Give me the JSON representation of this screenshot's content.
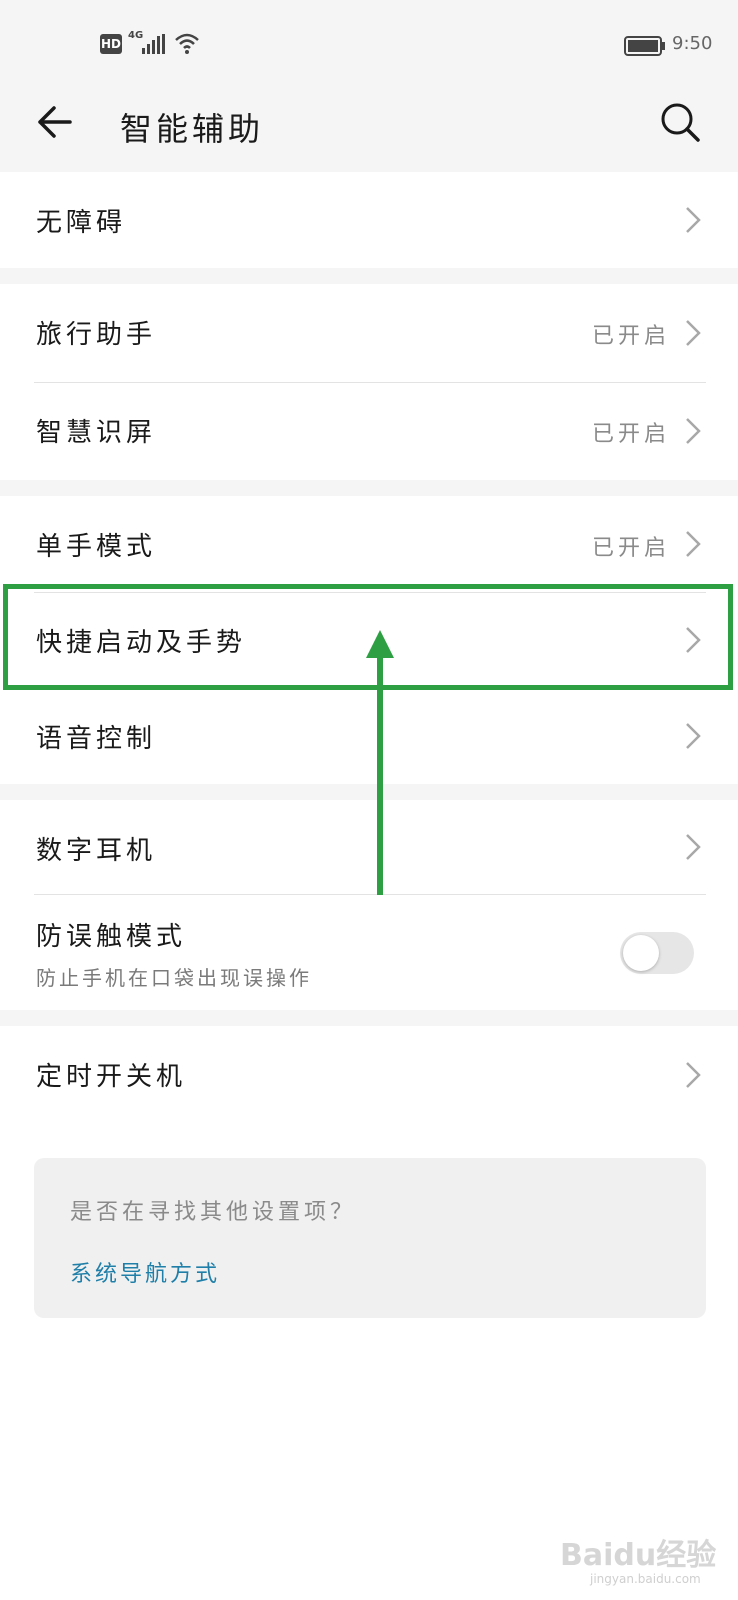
{
  "status_bar": {
    "hd": "HD",
    "network": "4G",
    "time": "9:50"
  },
  "header": {
    "title": "智能辅助",
    "back_icon": "arrow-left-icon",
    "search_icon": "search-icon"
  },
  "groups": [
    {
      "items": [
        {
          "label": "无障碍",
          "status": ""
        }
      ]
    },
    {
      "items": [
        {
          "label": "旅行助手",
          "status": "已开启"
        },
        {
          "label": "智慧识屏",
          "status": "已开启"
        }
      ]
    },
    {
      "items": [
        {
          "label": "单手模式",
          "status": "已开启"
        },
        {
          "label": "快捷启动及手势",
          "status": ""
        },
        {
          "label": "语音控制",
          "status": ""
        }
      ]
    },
    {
      "items": [
        {
          "label": "数字耳机",
          "status": ""
        },
        {
          "label": "防误触模式",
          "sublabel": "防止手机在口袋出现误操作",
          "toggle_on": false
        }
      ]
    },
    {
      "items": [
        {
          "label": "定时开关机",
          "status": ""
        }
      ]
    }
  ],
  "suggestion": {
    "question": "是否在寻找其他设置项？",
    "link": "系统导航方式"
  },
  "annotation": {
    "color": "#2ea043"
  },
  "watermark": {
    "text": "Baidu经验",
    "url": "jingyan.baidu.com"
  },
  "colors": {
    "background": "#f5f5f5",
    "card": "#ffffff",
    "link": "#1f7fa8",
    "status_text": "#8a8a8a"
  }
}
